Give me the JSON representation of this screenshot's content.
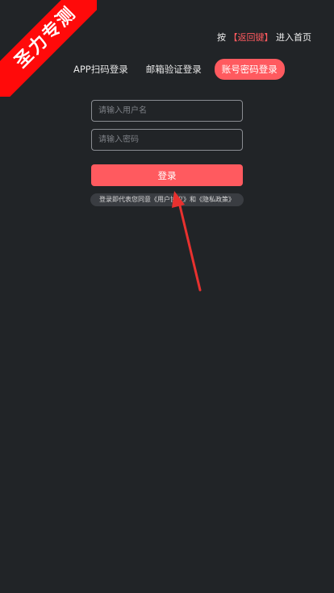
{
  "watermark": {
    "text": "圣力专测",
    "color": "#ff0a0a"
  },
  "hint": {
    "prefix": "按",
    "key": "【返回键】",
    "suffix": "进入首页"
  },
  "tabs": [
    {
      "label": "APP扫码登录",
      "active": false
    },
    {
      "label": "邮箱验证登录",
      "active": false
    },
    {
      "label": "账号密码登录",
      "active": true
    }
  ],
  "form": {
    "username_placeholder": "请输入用户名",
    "username_value": "",
    "password_placeholder": "请输入密码",
    "password_value": "",
    "login_label": "登录"
  },
  "agreement": {
    "prefix": "登录即代表您同意",
    "user_agreement": "《用户协议》",
    "conjunction": "和",
    "privacy_policy": "《隐私政策》"
  },
  "colors": {
    "background": "#212427",
    "accent": "#ff5a5f",
    "annotation_arrow": "#e8312f"
  }
}
